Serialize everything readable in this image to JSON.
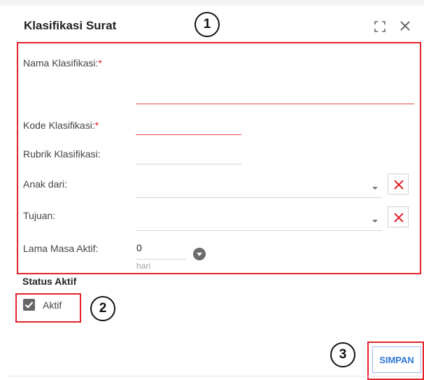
{
  "dialog": {
    "title": "Klasifikasi Surat"
  },
  "annotations": [
    "1",
    "2",
    "3"
  ],
  "form": {
    "nama": {
      "label": "Nama Klasifikasi:",
      "required": "*",
      "value": ""
    },
    "kode": {
      "label": "Kode Klasifikasi:",
      "required": "*",
      "value": ""
    },
    "rubrik": {
      "label": "Rubrik Klasifikasi:",
      "value": ""
    },
    "anak": {
      "label": "Anak dari:",
      "value": ""
    },
    "tujuan": {
      "label": "Tujuan:",
      "value": ""
    },
    "lama": {
      "label": "Lama Masa Aktif:",
      "value": "0",
      "unit": "hari"
    }
  },
  "status": {
    "title": "Status Aktif",
    "checkbox_label": "Aktif",
    "checked": true
  },
  "actions": {
    "save_label": "SIMPAN"
  },
  "icons": {
    "maximize": "maximize-icon",
    "close": "close-icon",
    "clear": "x-icon",
    "checkmark": "checkmark-icon"
  },
  "colors": {
    "highlight": "#e3212b",
    "required": "#e3212b",
    "clear_icon": "#e3212b",
    "primary": "#2f79d6"
  }
}
